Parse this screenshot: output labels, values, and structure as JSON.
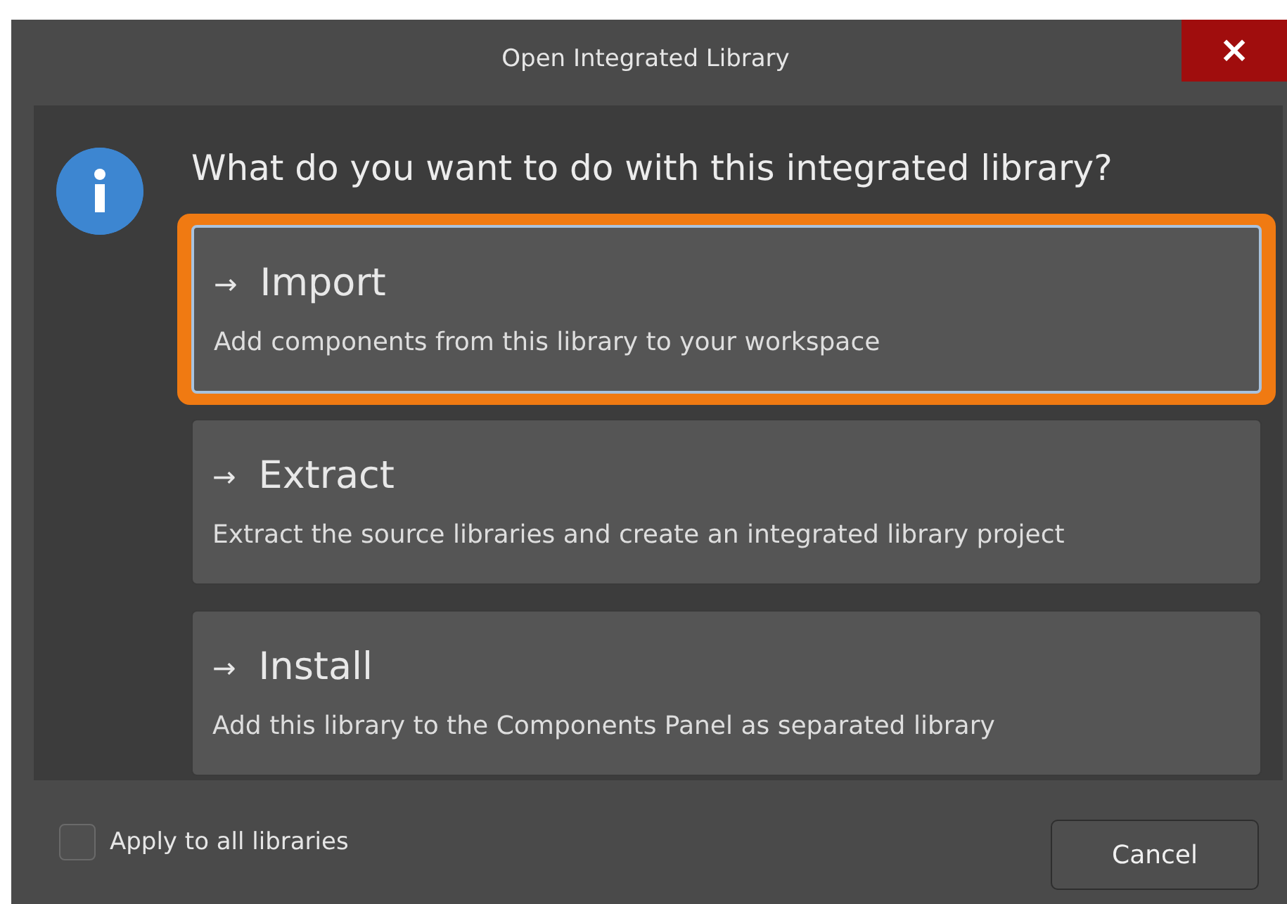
{
  "window": {
    "title": "Open Integrated Library",
    "close_label": "×"
  },
  "question": "What do you want to do with this integrated library?",
  "options": [
    {
      "arrow": "→",
      "title": "Import",
      "description": "Add components from this library to your workspace",
      "selected": true
    },
    {
      "arrow": "→",
      "title": "Extract",
      "description": "Extract the source libraries and create an integrated library project",
      "selected": false
    },
    {
      "arrow": "→",
      "title": "Install",
      "description": "Add this library to the Components Panel as separated library",
      "selected": false
    }
  ],
  "apply_all": {
    "label": "Apply to all libraries",
    "checked": false
  },
  "buttons": [
    {
      "label": "Cancel"
    }
  ]
}
